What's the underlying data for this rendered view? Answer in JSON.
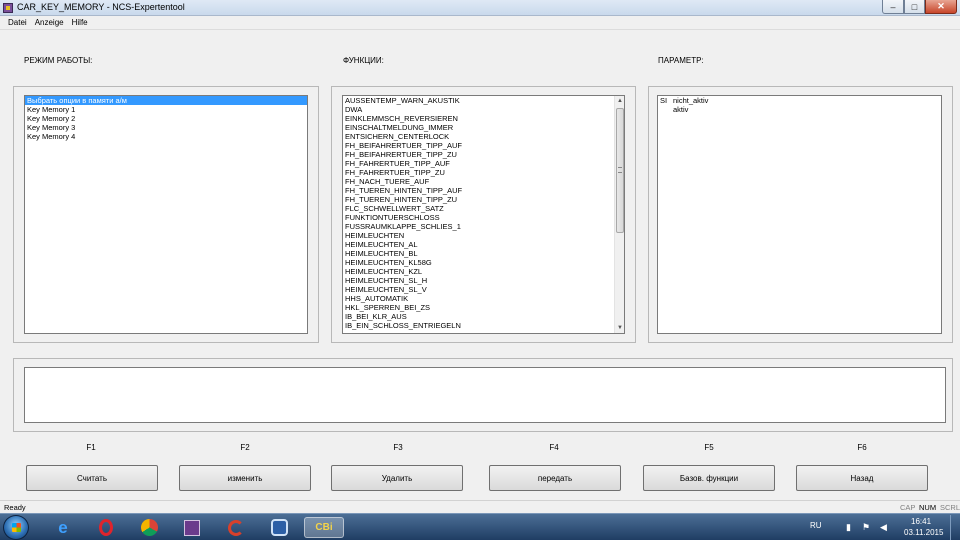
{
  "window": {
    "title": "CAR_KEY_MEMORY - NCS-Expertentool",
    "min_glyph": "–",
    "max_glyph": "□",
    "close_glyph": "✕"
  },
  "menu": [
    "Datei",
    "Anzeige",
    "Hilfe"
  ],
  "sections": {
    "mode_label": "РЕЖИМ РАБОТЫ:",
    "functions_label": "ФУНКЦИИ:",
    "parameter_label": "ПАРАМЕТР:"
  },
  "mode_list": {
    "items": [
      "Выбрать опции в памяти а/м",
      "Key Memory 1",
      "Key Memory 2",
      "Key Memory 3",
      "Key Memory 4"
    ],
    "selected_index": 0
  },
  "functions_list": {
    "items": [
      "AUSSENTEMP_WARN_AKUSTIK",
      "DWA",
      "EINKLEMMSCH_REVERSIEREN",
      "EINSCHALTMELDUNG_IMMER",
      "ENTSICHERN_CENTERLOCK",
      "FH_BEIFAHRERTUER_TIPP_AUF",
      "FH_BEIFAHRERTUER_TIPP_ZU",
      "FH_FAHRERTUER_TIPP_AUF",
      "FH_FAHRERTUER_TIPP_ZU",
      "FH_NACH_TUERE_AUF",
      "FH_TUEREN_HINTEN_TIPP_AUF",
      "FH_TUEREN_HINTEN_TIPP_ZU",
      "FLC_SCHWELLWERT_SATZ",
      "FUNKTIONTUERSCHLOSS",
      "FUSSRAUMKLAPPE_SCHLIES_1",
      "HEIMLEUCHTEN",
      "HEIMLEUCHTEN_AL",
      "HEIMLEUCHTEN_BL",
      "HEIMLEUCHTEN_KL58G",
      "HEIMLEUCHTEN_KZL",
      "HEIMLEUCHTEN_SL_H",
      "HEIMLEUCHTEN_SL_V",
      "HHS_AUTOMATIK",
      "HKL_SPERREN_BEI_ZS",
      "IB_BEI_KLR_AUS",
      "IB_EIN_SCHLOSS_ENTRIEGELN"
    ],
    "scroll_up": "▲",
    "scroll_down": "▼"
  },
  "parameter_list": [
    {
      "key": "SI",
      "value": "nicht_aktiv"
    },
    {
      "key": "",
      "value": "aktiv"
    }
  ],
  "fkeys": [
    {
      "key": "F1",
      "label": "Считать"
    },
    {
      "key": "F2",
      "label": "изменить"
    },
    {
      "key": "F3",
      "label": "Удалить"
    },
    {
      "key": "F4",
      "label": "передать"
    },
    {
      "key": "F5",
      "label": "Базов. функции"
    },
    {
      "key": "F6",
      "label": "Назад"
    }
  ],
  "status": {
    "ready": "Ready",
    "cap": "CAP",
    "num": "NUM",
    "scrl": "SCRL"
  },
  "taskbar": {
    "active_app_label": "CBi",
    "language": "RU",
    "time": "16:41",
    "date": "03.11.2015",
    "icons": [
      "start-orb-icon",
      "internet-explorer-icon",
      "opera-icon",
      "chrome-icon",
      "floppy-icon",
      "ccleaner-icon",
      "app-circle-icon",
      "ncs-expert-icon"
    ]
  }
}
